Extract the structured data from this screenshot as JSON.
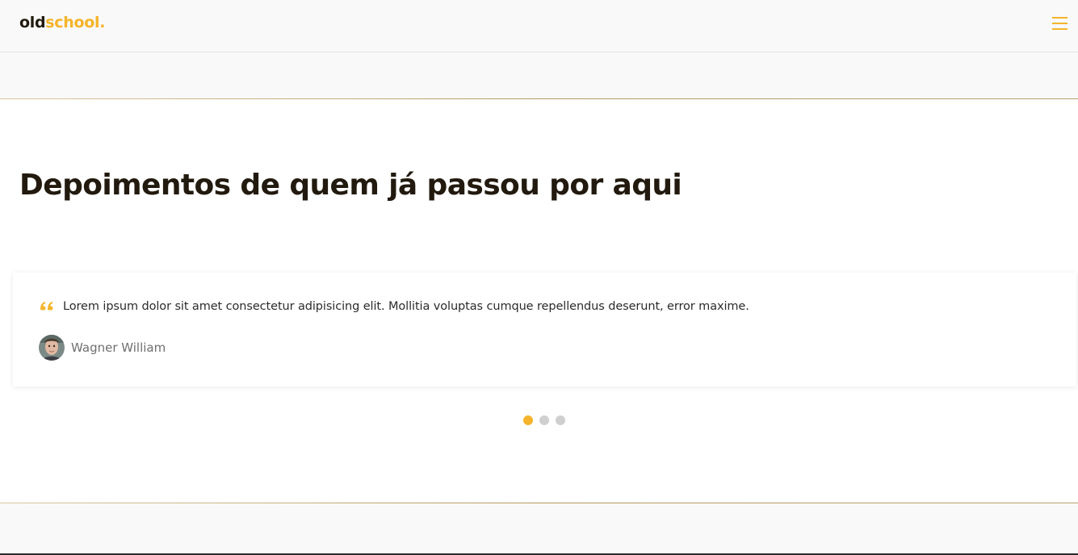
{
  "header": {
    "logo_dark": "old",
    "logo_accent": "school.",
    "menu_icon": "hamburger-menu-icon"
  },
  "testimonials": {
    "title": "Depoimentos de quem já passou por aqui",
    "items": [
      {
        "quote": "Lorem ipsum dolor sit amet consectetur adipisicing elit. Mollitia voluptas cumque repellendus deserunt, error maxime.",
        "author": "Wagner William",
        "quote_icon": "quote-icon",
        "avatar_icon": "avatar"
      }
    ],
    "pagination": {
      "total": 3,
      "active": 1
    }
  },
  "colors": {
    "accent": "#f5b42a",
    "title": "#221a0e",
    "gold_line": "#b89a5e",
    "dot_inactive": "#cfcfcf",
    "background_gray": "#f9f9f9"
  }
}
